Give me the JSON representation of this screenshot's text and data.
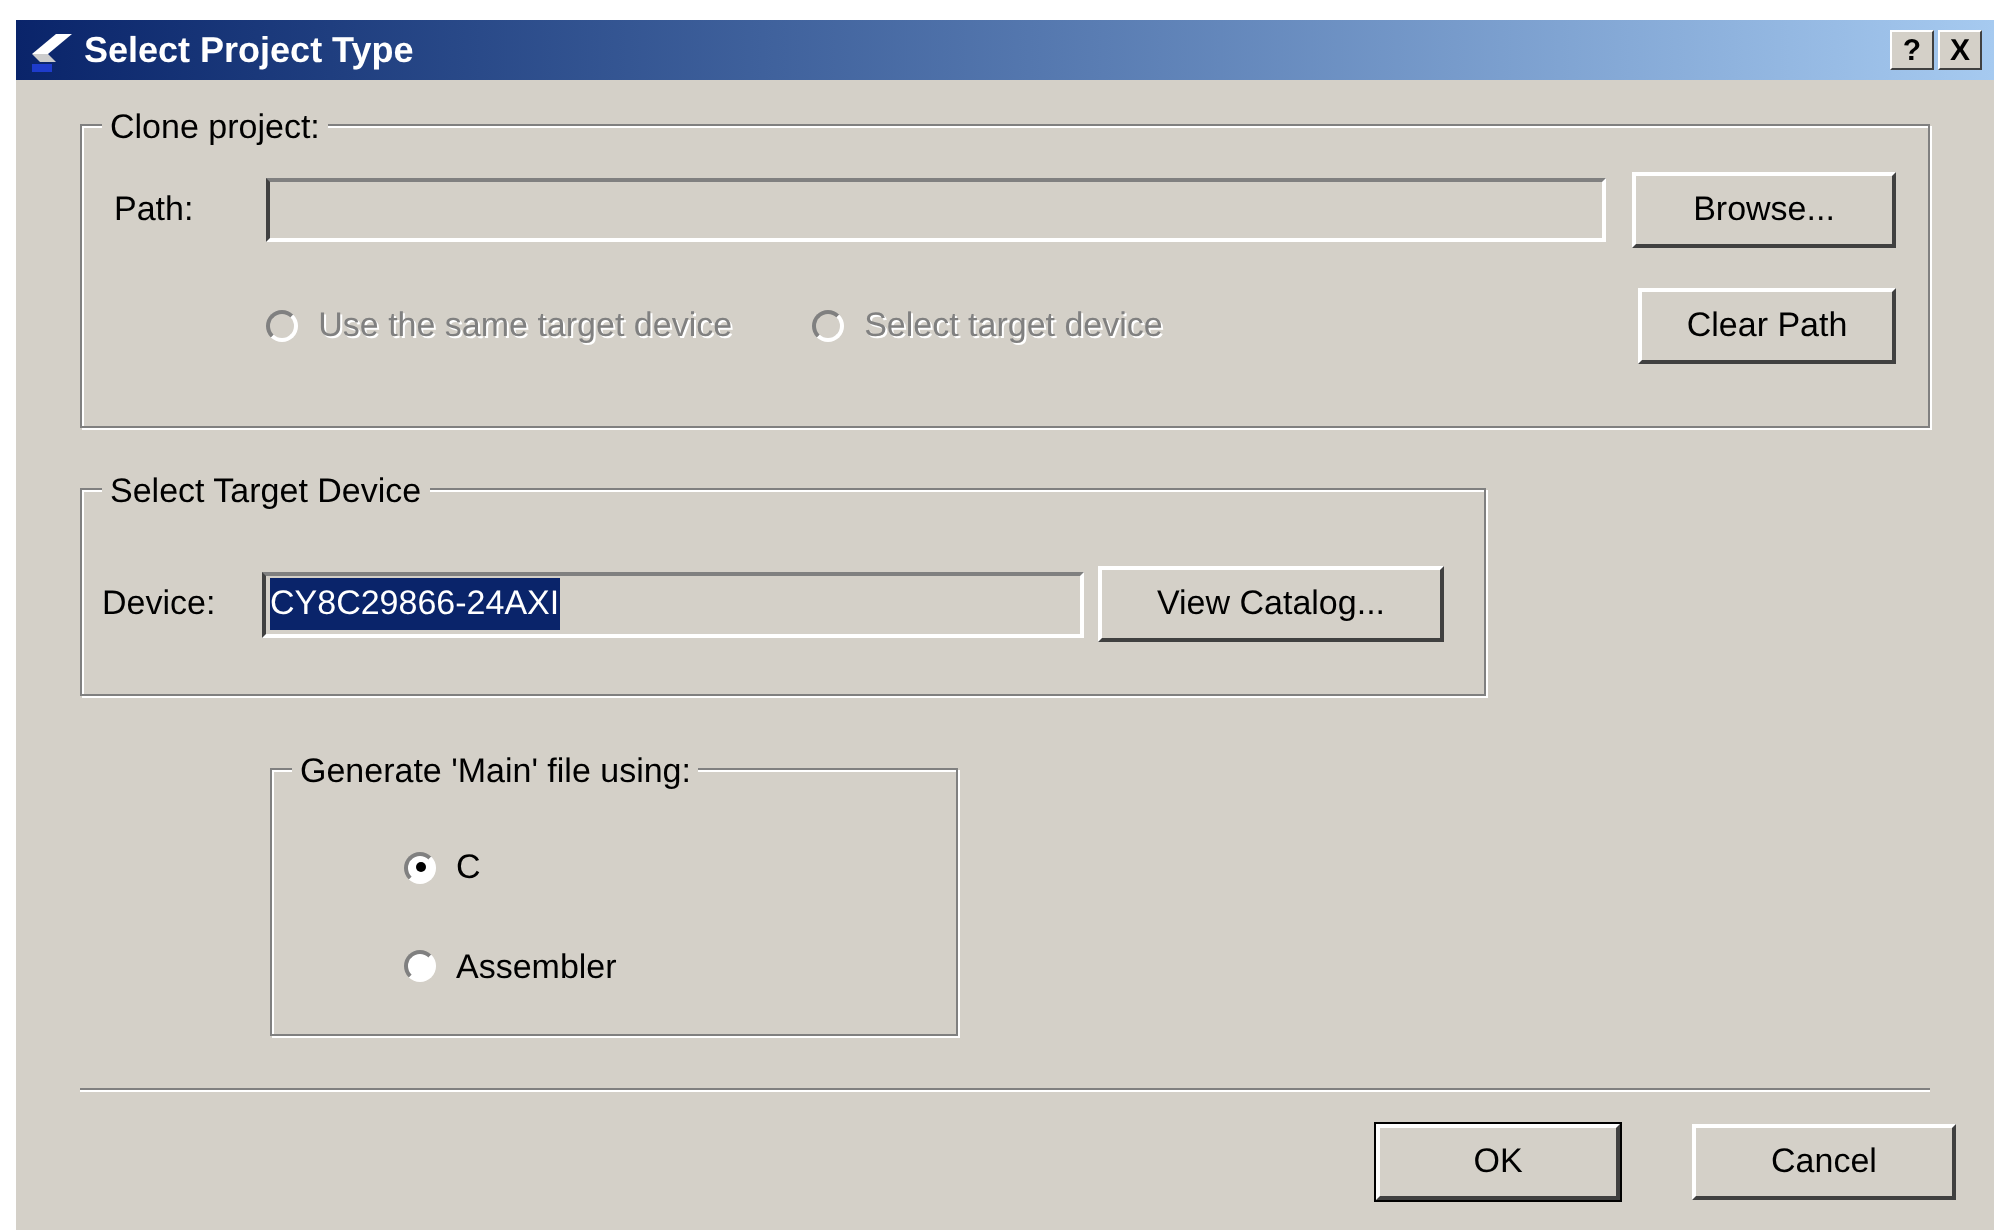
{
  "window": {
    "title": "Select Project Type",
    "help_button": "?",
    "close_button": "X"
  },
  "clone_group": {
    "title": "Clone project:",
    "path_label": "Path:",
    "disabled": true,
    "browse_button": "Browse...",
    "clear_button": "Clear Path",
    "options": [
      {
        "label": "Use the same target device",
        "selected": false
      },
      {
        "label": "Select target device",
        "selected": false
      }
    ]
  },
  "device_group": {
    "title": "Select Target Device",
    "device_label": "Device:",
    "device_value": "CY8C29866-24AXI",
    "value_selected": true,
    "catalog_button": "View Catalog..."
  },
  "main_group": {
    "title": "Generate 'Main' file using:",
    "options": [
      {
        "label": "C",
        "selected": true
      },
      {
        "label": "Assembler",
        "selected": false
      }
    ]
  },
  "buttons": [
    {
      "label": "OK",
      "default": true
    },
    {
      "label": "Cancel",
      "default": false
    }
  ]
}
